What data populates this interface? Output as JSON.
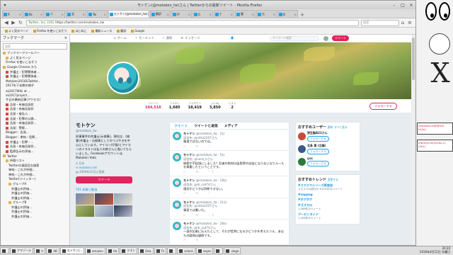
{
  "window": {
    "title": "モトケン(@motoken_tw)さん | Twitterからの最新ツイート - Mozilla Firefox"
  },
  "tabs": [
    {
      "label": "R"
    },
    {
      "label": "Bc"
    },
    {
      "label": "ニ"
    },
    {
      "label": "全"
    },
    {
      "label": "Tw"
    },
    {
      "label": "モトケン(@motoken_tw)さん"
    },
    {
      "label": "翻訳"
    },
    {
      "label": "Ff"
    },
    {
      "label": "G"
    },
    {
      "label": "T"
    },
    {
      "label": "論"
    },
    {
      "label": "Tl"
    },
    {
      "label": "B"
    }
  ],
  "navbar": {
    "back": "◀",
    "forward": "▶",
    "secure": "Twitter, Inc. (US)",
    "url": "https://twitter.com/motoken_tw",
    "search_placeholder": "検索",
    "reload": "↻",
    "home": "⌂",
    "menu": "≡"
  },
  "bookmarks": [
    {
      "label": "よく見るページ"
    },
    {
      "label": "Firefox を使いこなそう"
    },
    {
      "label": "はじめに"
    },
    {
      "label": "最新ニュース"
    },
    {
      "label": "翻訳"
    },
    {
      "label": "Google"
    }
  ],
  "sidebar": {
    "title": "ブックマーク",
    "close": "×",
    "search_placeholder": "検索",
    "items": [
      {
        "label": "ブックマークツールバー",
        "type": "folder"
      },
      {
        "label": "よく見るページ",
        "type": "folder"
      },
      {
        "label": "Firefox を使いこなそう",
        "type": "page"
      },
      {
        "label": "Google Chrome から",
        "type": "folder"
      },
      {
        "label": "弁護士・犯罪関係者...",
        "type": "red"
      },
      {
        "label": "弁護士・犯罪関係者...",
        "type": "red"
      },
      {
        "label": "Motoken2016&Twitter...",
        "type": "page"
      },
      {
        "label": "2017年下半期の様子",
        "type": "page"
      },
      {
        "label": "xk2017Wiki at ...",
        "type": "page"
      },
      {
        "label": "xk2017project...",
        "type": "page"
      },
      {
        "label": "今日の最新記事(アクセス)",
        "type": "page"
      },
      {
        "label": "告発・有価告訴状",
        "type": "red"
      },
      {
        "label": "告発・有価告発状",
        "type": "red"
      },
      {
        "label": "告発・被告人...",
        "type": "red"
      },
      {
        "label": "告発・犯罪の公開...",
        "type": "red"
      },
      {
        "label": "告発・有価告発状...",
        "type": "red"
      },
      {
        "label": "告発：警察...",
        "type": "red"
      },
      {
        "label": "Blogger：告発...",
        "type": "page"
      },
      {
        "label": "Blogger：単純・犯罪...",
        "type": "page"
      },
      {
        "label": "弁護士・犯罪・...",
        "type": "red"
      },
      {
        "label": "告発・有価告発状...",
        "type": "red"
      },
      {
        "label": "監察告示の評価...",
        "type": "red"
      },
      {
        "label": "Twitter",
        "type": "folder"
      },
      {
        "label": "仲間リスト",
        "type": "folder"
      },
      {
        "label": "Twitterの真面目な検索",
        "type": "page"
      },
      {
        "label": "単純・これが仲間...",
        "type": "page"
      },
      {
        "label": "単純・これが仲間...",
        "type": "page"
      },
      {
        "label": "Twitter(ツイッター)",
        "type": "page"
      },
      {
        "label": "グループA",
        "type": "folder"
      },
      {
        "label": "弁護士の評価...",
        "type": "page"
      },
      {
        "label": "弁護士の評価...",
        "type": "page"
      },
      {
        "label": "弁護士の評価...",
        "type": "page"
      },
      {
        "label": "グループB",
        "type": "folder"
      },
      {
        "label": "弁護士の評価...",
        "type": "page"
      },
      {
        "label": "弁護士の評価...",
        "type": "page"
      },
      {
        "label": "弁護士の評価...",
        "type": "page"
      }
    ]
  },
  "twitter_nav": {
    "home": "ホーム",
    "moments": "モーメント",
    "notifications": "通知",
    "messages": "メッセージ",
    "search_placeholder": "キーワード検索",
    "tweet_button": "ツイート"
  },
  "stats": [
    {
      "label": "ツイート",
      "value": "104,516"
    },
    {
      "label": "フォロー",
      "value": "1,685"
    },
    {
      "label": "フォロワー",
      "value": "18,419"
    },
    {
      "label": "いいね",
      "value": "3,850"
    },
    {
      "label": "リスト",
      "value": "2"
    }
  ],
  "follow_button": "フォローする",
  "profile": {
    "name": "モトケン",
    "handle": "@motoken_tw",
    "bio": "刑事事件の弁護士(元検事)。現在は、(検事)弁護士・元検事としてのつぶやきを中心にしています。アイコン(仔猫)とアイコンのイラストは友人の娘さんに描いてもらいました。Facebookアカウントは、Motoken Yoda",
    "location": "日本",
    "link": "motoken.net",
    "joined": "2009年12月に登録",
    "tweet_button": "ツイート",
    "photos_label": "761 画像と動画"
  },
  "timeline": {
    "tab_tweets": "ツイート",
    "tab_replies": "ツイートと返信",
    "tab_media": "メディア",
    "tweets": [
      {
        "name": "モトケン",
        "handle": "@motoken_tw · 2分",
        "reply": "返信先: @nitta2207さん",
        "text": "報道ではないのでは。",
        "replies": "",
        "rts": "",
        "likes": ""
      },
      {
        "name": "モトケン",
        "handle": "@motoken_tw · 5分",
        "reply": "返信先: @Lenz_kさん",
        "text": "検察が不起訴にしました？記者の取材は出版界の自由にならないなりルールを尊重したということです。",
        "replies": "",
        "rts": "",
        "likes": "1"
      },
      {
        "name": "モトケン",
        "handle": "@motoken_tw · 18分",
        "reply": "返信先: @di_ssd74さん",
        "text": "適切かどうかは判断できない。",
        "replies": "",
        "rts": "",
        "likes": ""
      },
      {
        "name": "モトケン",
        "handle": "@motoken_tw · 21分",
        "reply": "返信先: @nitta2207さん",
        "text": "事実では書いた。",
        "replies": "",
        "rts": "",
        "likes": "3"
      },
      {
        "name": "モトケン",
        "handle": "@motoken_tw · 28分",
        "reply": "返信先: @di_ssd74さん",
        "text": "一部の記者に伝えたとして、それが世界になるかどうかを考えたうえ、あなたの疑問は疑問です。",
        "replies": "",
        "rts": "",
        "likes": ""
      }
    ]
  },
  "who_to_follow": {
    "title": "おすすめユーザー",
    "refresh": "更新",
    "all": "すべて見る",
    "users": [
      {
        "name": "弥生製A21さん",
        "sub": "",
        "btn": "フォローする",
        "color": "#c94a3a"
      },
      {
        "name": "北条 東 (北條)",
        "sub": "@Sashuh",
        "btn": "フォローする",
        "color": "#3a5a8a"
      },
      {
        "name": "yxx",
        "sub": "@yxxx",
        "btn": "フォローする",
        "color": "#2a7a3a"
      }
    ]
  },
  "trends": {
    "title": "おすすめトレンド",
    "change": "変更する",
    "items": [
      {
        "tag": "#スマスマシリーズ再放送",
        "desc": "スマスマの部分が 8,931件のツイート"
      },
      {
        "tag": "#sappeg",
        "desc": ""
      },
      {
        "tag": "#ボグボゲ",
        "desc": ""
      },
      {
        "tag": "#ゴズカロ",
        "desc": "1,088件のツイート"
      },
      {
        "tag": "アーセンタイド",
        "desc": "1,456件のツイート"
      }
    ]
  },
  "taskbar": {
    "items": [
      {
        "label": "アマゾール"
      },
      {
        "label": "tr"
      },
      {
        "label": "AB"
      },
      {
        "label": "モトケン(..."
      },
      {
        "label": "amazon"
      },
      {
        "label": "Ha"
      },
      {
        "label": "テスト"
      },
      {
        "label": "Elsa"
      },
      {
        "label": "Tk"
      },
      {
        "label": ""
      },
      {
        "label": "xclock"
      },
      {
        "label": "xeyes"
      },
      {
        "label": ""
      },
      {
        "label": "xlogo"
      }
    ],
    "time": "20:20",
    "date": "2018年4月12日 木曜日"
  },
  "desktop": {
    "xterm1": "mmeeee-vs@@me-tr(0x)",
    "xterm2": "mtmmy-re(2016x-1)(0x1)"
  }
}
